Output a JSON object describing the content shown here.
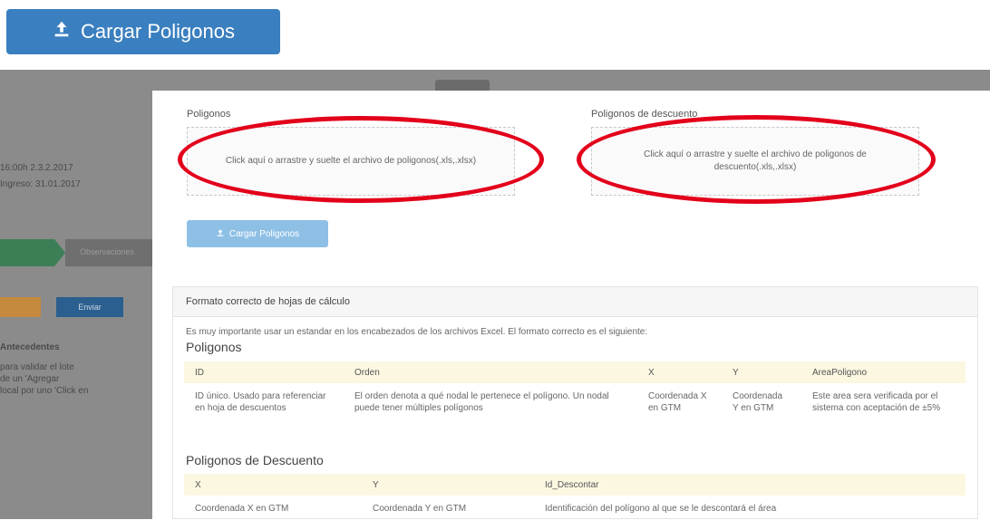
{
  "top_button": {
    "label": "Cargar Poligonos",
    "icon": "upload-icon"
  },
  "background": {
    "lines": [
      "16:00h 2.3.2.2017",
      "Ingreso: 31.01.2017"
    ],
    "heading": "Antecedentes",
    "para": [
      "para validar el lote",
      "de un 'Agregar",
      "local por uno 'Click en"
    ],
    "step_label": "Observaciones",
    "btn_label": "Enviar"
  },
  "modal": {
    "label_poligonos": "Poligonos",
    "label_descuento": "Poligonos de descuento",
    "dropzone_poligonos": "Click aquí o arrastre y suelte el archivo de poligonos(.xls,.xlsx)",
    "dropzone_descuento": "Click aquí o arrastre y suelte el archivo de poligonos de descuento(.xls,.xlsx)",
    "cargar_button": "Cargar Poligonos",
    "panel": {
      "title": "Formato correcto de hojas de cálculo",
      "intro": "Es muy importante usar un estandar en los encabezados de los archivos Excel. El formato correcto es el siguiente:",
      "section1": {
        "title": "Poligonos",
        "headers": [
          "ID",
          "Orden",
          "X",
          "Y",
          "AreaPoligono"
        ],
        "rows": [
          [
            "ID único. Usado para referenciar en hoja de descuentos",
            "El orden denota a qué nodal le pertenece el polígono. Un nodal puede tener múltiples polígonos",
            "Coordenada X en GTM",
            "Coordenada Y en GTM",
            "Este area sera verificada por el sistema con aceptación de ±5%"
          ]
        ]
      },
      "section2": {
        "title": "Poligonos de Descuento",
        "headers": [
          "X",
          "Y",
          "Id_Descontar"
        ],
        "rows": [
          [
            "Coordenada X en GTM",
            "Coordenada Y en GTM",
            "Identificación del polígono al que se le descontará el área"
          ]
        ]
      }
    }
  },
  "annotation_color": "#e3001b"
}
